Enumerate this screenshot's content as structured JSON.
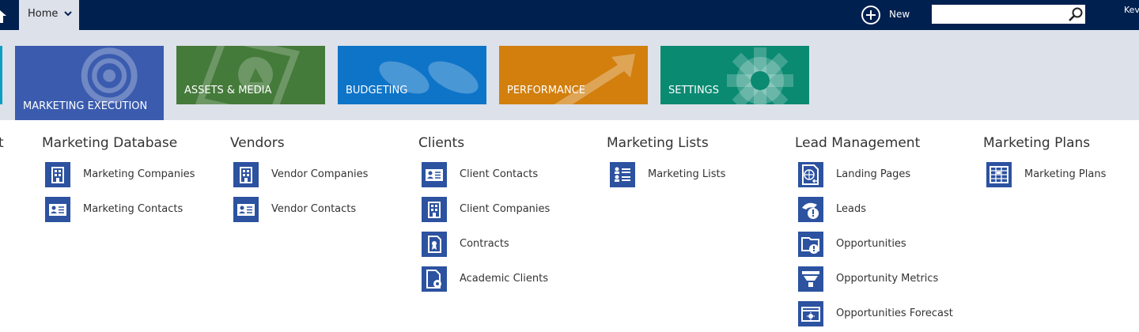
{
  "topbar": {
    "home_label": "Home",
    "new_label": "New",
    "search_placeholder": "",
    "user_partial": "Kev"
  },
  "tiles": [
    {
      "label": "MARKETING EXECUTION",
      "color": "#3a5bae",
      "icon": "target-icon"
    },
    {
      "label": "ASSETS & MEDIA",
      "color": "#447a3a",
      "icon": "media-icon"
    },
    {
      "label": "BUDGETING",
      "color": "#0e74c8",
      "icon": "coins-icon"
    },
    {
      "label": "PERFORMANCE",
      "color": "#d27f0e",
      "icon": "trend-icon"
    },
    {
      "label": "SETTINGS",
      "color": "#0b8a72",
      "icon": "gear-icon"
    }
  ],
  "menu": {
    "cut_title": "t",
    "groups": [
      {
        "title": "Marketing Database",
        "items": [
          {
            "label": "Marketing Companies",
            "icon": "building-icon"
          },
          {
            "label": "Marketing Contacts",
            "icon": "contact-card-icon"
          }
        ]
      },
      {
        "title": "Vendors",
        "items": [
          {
            "label": "Vendor Companies",
            "icon": "building-icon"
          },
          {
            "label": "Vendor Contacts",
            "icon": "contact-card-icon"
          }
        ]
      },
      {
        "title": "Clients",
        "items": [
          {
            "label": "Client Contacts",
            "icon": "contact-card-icon"
          },
          {
            "label": "Client Companies",
            "icon": "building-icon"
          },
          {
            "label": "Contracts",
            "icon": "contract-icon"
          },
          {
            "label": "Academic Clients",
            "icon": "document-gear-icon"
          }
        ]
      },
      {
        "title": "Marketing Lists",
        "items": [
          {
            "label": "Marketing Lists",
            "icon": "people-list-icon"
          }
        ]
      },
      {
        "title": "Lead Management",
        "items": [
          {
            "label": "Landing Pages",
            "icon": "globe-page-icon"
          },
          {
            "label": "Leads",
            "icon": "phone-alert-icon"
          },
          {
            "label": "Opportunities",
            "icon": "folder-alert-icon"
          },
          {
            "label": "Opportunity Metrics",
            "icon": "funnel-icon"
          },
          {
            "label": "Opportunities Forecast",
            "icon": "forecast-icon"
          }
        ]
      },
      {
        "title": "Marketing Plans",
        "items": [
          {
            "label": "Marketing Plans",
            "icon": "calendar-plan-icon"
          }
        ]
      }
    ]
  }
}
